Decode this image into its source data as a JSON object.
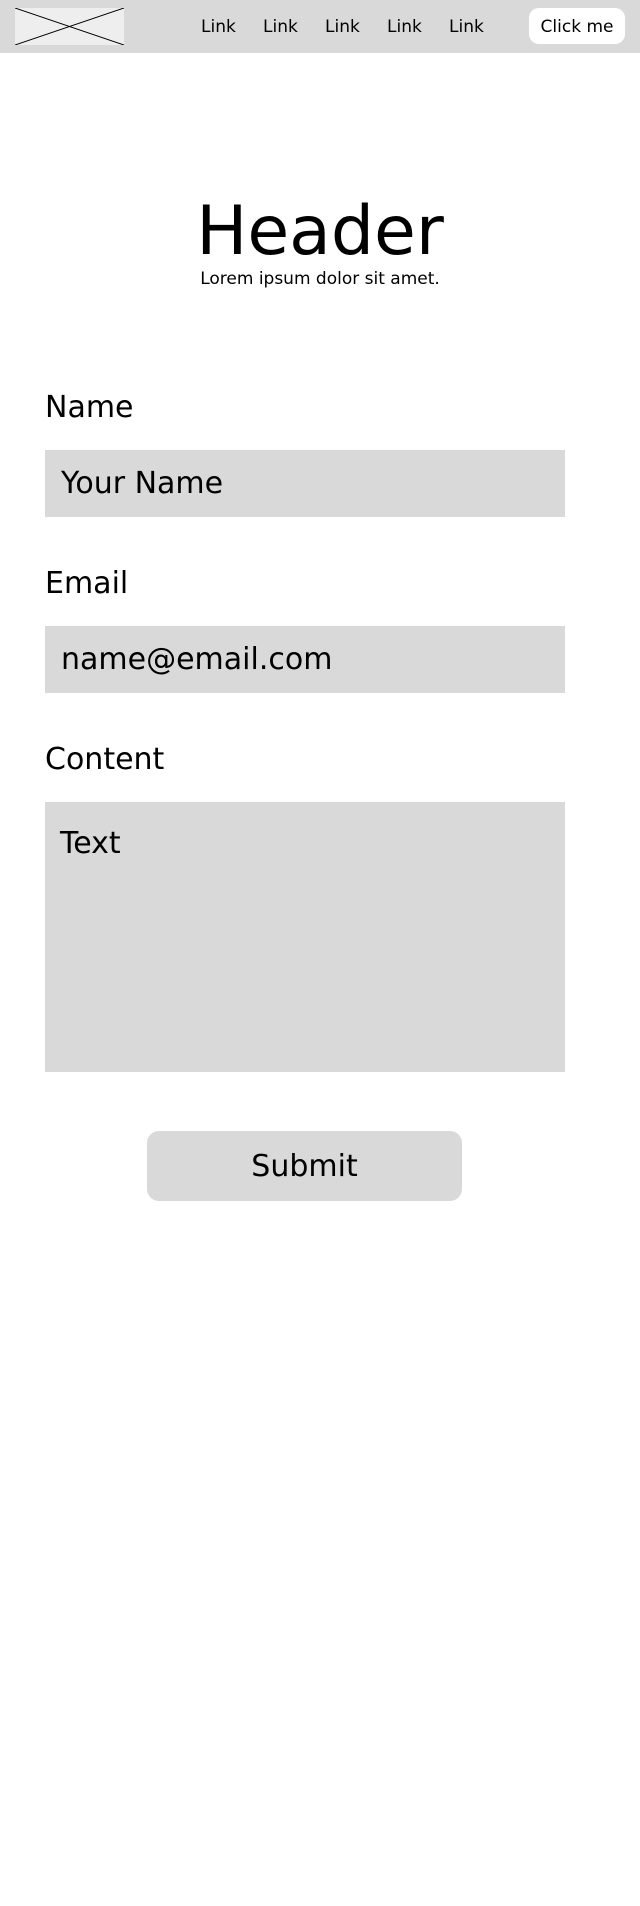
{
  "navbar": {
    "logo_icon": "image-placeholder-icon",
    "links": [
      "Link",
      "Link",
      "Link",
      "Link",
      "Link"
    ],
    "cta_label": "Click me"
  },
  "hero": {
    "title": "Header",
    "subtitle": "Lorem ipsum dolor sit amet."
  },
  "form": {
    "name": {
      "label": "Name",
      "placeholder": "Your Name",
      "value": ""
    },
    "email": {
      "label": "Email",
      "placeholder": "name@email.com",
      "value": ""
    },
    "content": {
      "label": "Content",
      "placeholder": "Text",
      "value": ""
    },
    "submit_label": "Submit"
  },
  "colors": {
    "navbar_bg": "#d9d9d9",
    "field_bg": "#d9d9d9",
    "logo_bg": "#eeeeee",
    "page_bg": "#ffffff",
    "text": "#000000"
  }
}
